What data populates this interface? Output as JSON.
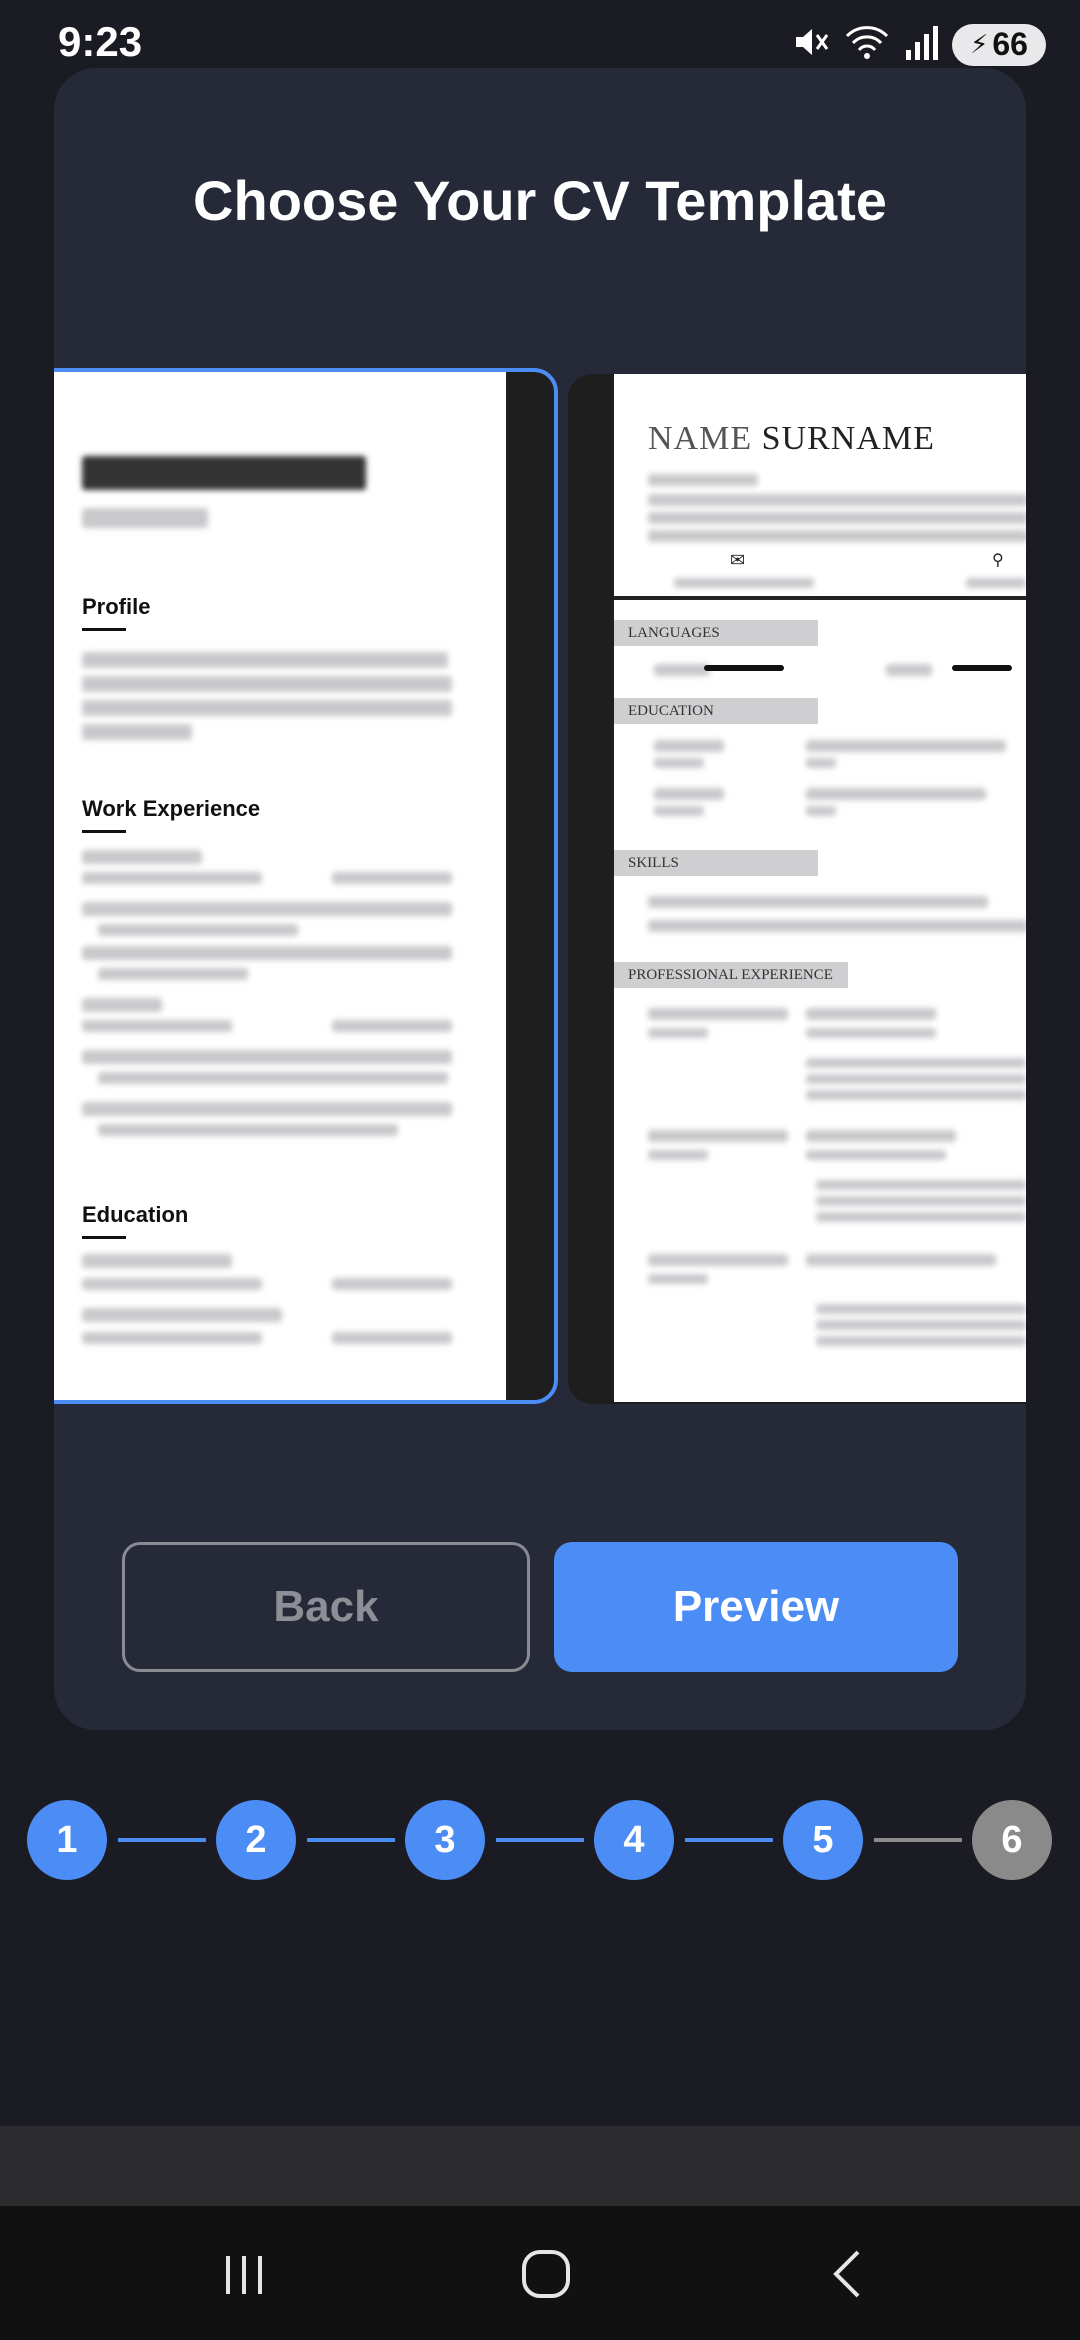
{
  "status": {
    "time": "9:23",
    "battery": "66"
  },
  "screen": {
    "title": "Choose Your CV Template"
  },
  "templates": [
    {
      "sections": [
        "Profile",
        "Work Experience",
        "Education"
      ]
    },
    {
      "name_first": "NAME",
      "name_last": "SURNAME",
      "sections": [
        "LANGUAGES",
        "EDUCATION",
        "SKILLS",
        "PROFESSIONAL EXPERIENCE"
      ]
    }
  ],
  "buttons": {
    "back": "Back",
    "preview": "Preview"
  },
  "steps": [
    {
      "label": "1",
      "done": true
    },
    {
      "label": "2",
      "done": true
    },
    {
      "label": "3",
      "done": true
    },
    {
      "label": "4",
      "done": true
    },
    {
      "label": "5",
      "done": true
    },
    {
      "label": "6",
      "done": false
    }
  ],
  "colors": {
    "accent": "#4b8cf5",
    "card": "#262937",
    "background": "#1b1c23",
    "inactive": "#8a8a8a"
  }
}
